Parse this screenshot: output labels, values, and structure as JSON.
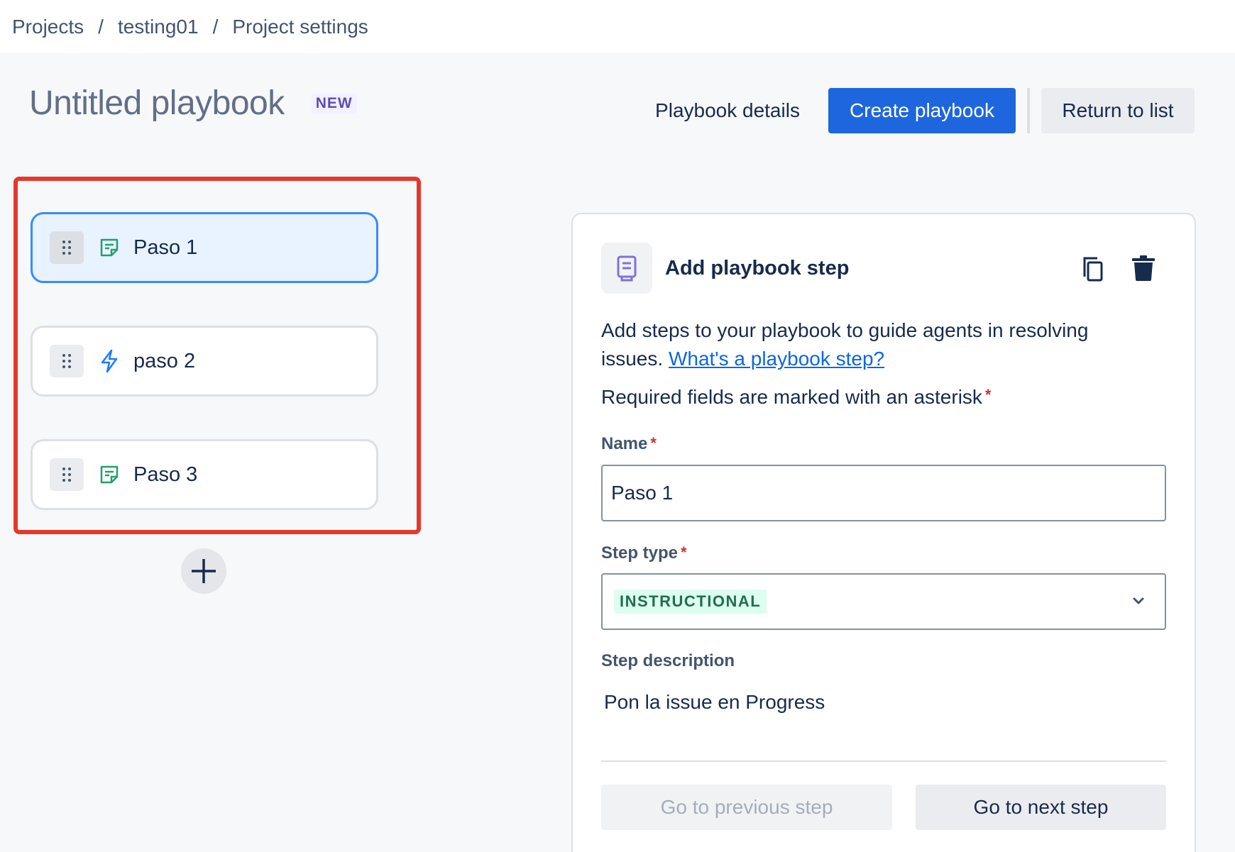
{
  "breadcrumbs": [
    "Projects",
    "testing01",
    "Project settings"
  ],
  "breadcrumb_separator": "/",
  "page": {
    "title": "Untitled playbook",
    "badge": "NEW"
  },
  "header_buttons": {
    "details": "Playbook details",
    "create": "Create playbook",
    "return": "Return to list"
  },
  "steps": [
    {
      "label": "Paso 1",
      "icon": "note-icon",
      "selected": true
    },
    {
      "label": "paso 2",
      "icon": "lightning-icon",
      "selected": false
    },
    {
      "label": "Paso 3",
      "icon": "note-icon",
      "selected": false
    }
  ],
  "panel": {
    "title": "Add playbook step",
    "intro_text": "Add steps to your playbook to guide agents in resolving issues.",
    "intro_link": "What's a playbook step?",
    "required_note": "Required fields are marked with an asterisk",
    "asterisk": "*",
    "name_label": "Name",
    "name_value": "Paso 1",
    "step_type_label": "Step type",
    "step_type_value": "INSTRUCTIONAL",
    "description_label": "Step description",
    "description_value": "Pon la issue en Progress",
    "prev_button": "Go to previous step",
    "next_button": "Go to next step"
  },
  "colors": {
    "primary": "#1d66de",
    "highlight": "#e5382d",
    "selected_border": "#388bff",
    "lozenge_bg": "#dcfff1",
    "lozenge_text": "#216e4e"
  }
}
